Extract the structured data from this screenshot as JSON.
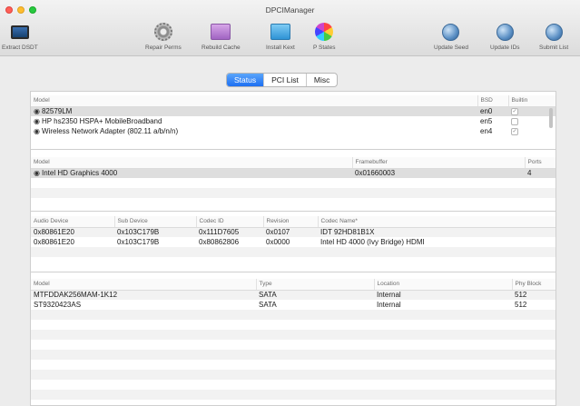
{
  "window": {
    "title": "DPCIManager"
  },
  "toolbar": {
    "extract_dsdt": "Extract DSDT",
    "repair_perms": "Repair Perms",
    "rebuild_cache": "Rebuild Cache",
    "install_kext": "Install Kext",
    "p_states": "P States",
    "update_seed": "Update Seed",
    "update_ids": "Update IDs",
    "submit_list": "Submit List"
  },
  "tabs": [
    "Status",
    "PCI List",
    "Misc"
  ],
  "network": {
    "headers": [
      "Model",
      "BSD",
      "Builtin"
    ],
    "rows": [
      {
        "model": "82579LM",
        "bsd": "en0",
        "builtin": "✓"
      },
      {
        "model": "HP hs2350 HSPA+ MobileBroadband",
        "bsd": "en5",
        "builtin": ""
      },
      {
        "model": "Wireless Network Adapter (802.11 a/b/n/n)",
        "bsd": "en4",
        "builtin": "✓"
      }
    ]
  },
  "graphics": {
    "headers": [
      "Model",
      "Framebuffer",
      "Ports"
    ],
    "rows": [
      {
        "model": "Intel HD Graphics 4000",
        "framebuffer": "0x01660003",
        "ports": "4"
      }
    ]
  },
  "audio": {
    "headers": [
      "Audio Device",
      "Sub Device",
      "Codec ID",
      "Revision",
      "Codec Name*"
    ],
    "rows": [
      {
        "device": "0x80861E20",
        "sub": "0x103C179B",
        "codec_id": "0x111D7605",
        "revision": "0x0107",
        "name": "IDT 92HD81B1X"
      },
      {
        "device": "0x80861E20",
        "sub": "0x103C179B",
        "codec_id": "0x80862806",
        "revision": "0x0000",
        "name": "Intel HD 4000 (Ivy Bridge) HDMI"
      }
    ]
  },
  "storage": {
    "headers": [
      "Model",
      "Type",
      "Location",
      "Phy Block"
    ],
    "rows": [
      {
        "model": "MTFDDAK256MAM-1K12",
        "type": "SATA",
        "location": "Internal",
        "block": "512"
      },
      {
        "model": "ST9320423AS",
        "type": "SATA",
        "location": "Internal",
        "block": "512"
      }
    ]
  }
}
